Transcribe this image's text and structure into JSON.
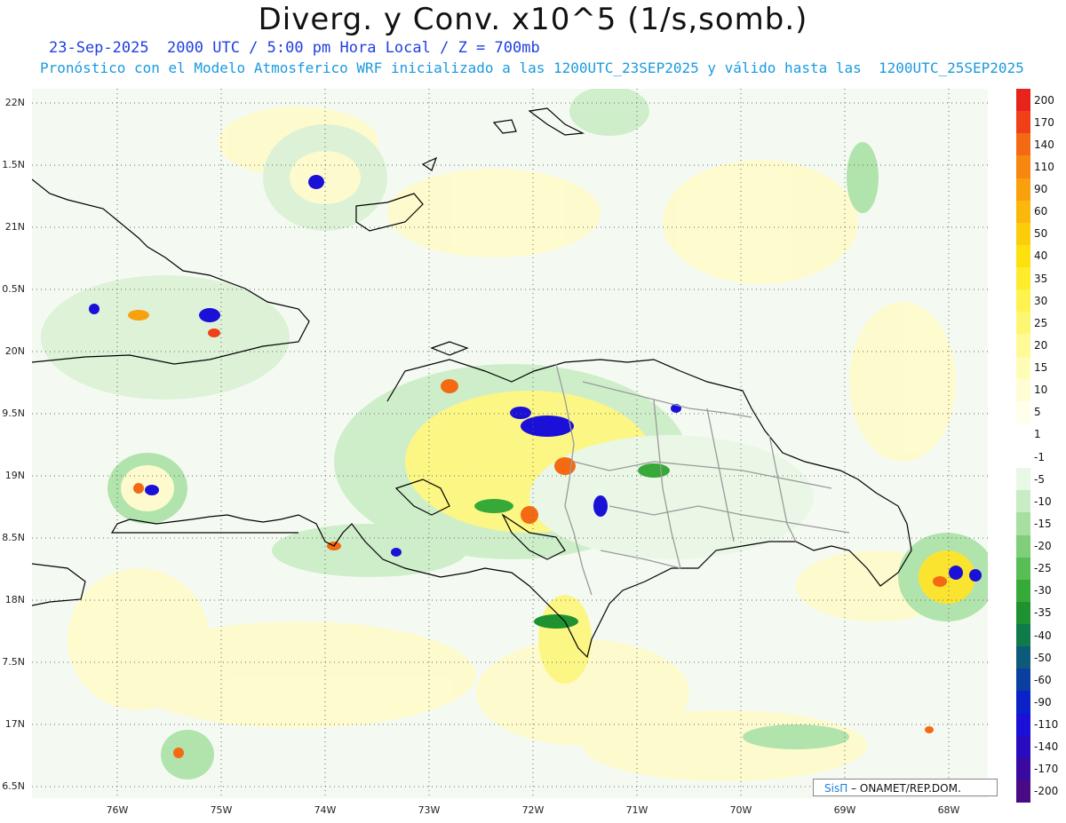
{
  "title": "Diverg. y Conv. x10^5 (1/s,somb.)",
  "subtitle_time": "23-Sep-2025  2000 UTC / 5:00 pm Hora Local / Z = 700mb",
  "subtitle_model": "Pronóstico con el Modelo Atmosferico WRF inicializado a las 1200UTC_23SEP2025 y válido hasta las  1200UTC_25SEP2025",
  "lat_labels": [
    "22N",
    "1.5N",
    "21N",
    "0.5N",
    "20N",
    "9.5N",
    "19N",
    "8.5N",
    "18N",
    "7.5N",
    "17N",
    "6.5N"
  ],
  "lon_labels": [
    "76W",
    "75W",
    "74W",
    "73W",
    "72W",
    "71W",
    "70W",
    "69W",
    "68W"
  ],
  "colorbar": {
    "labels": [
      "200",
      "170",
      "140",
      "110",
      "90",
      "60",
      "50",
      "40",
      "35",
      "30",
      "25",
      "20",
      "15",
      "10",
      "5",
      "1",
      "-1",
      "-5",
      "-10",
      "-15",
      "-20",
      "-25",
      "-30",
      "-35",
      "-40",
      "-50",
      "-60",
      "-90",
      "-110",
      "-140",
      "-170",
      "-200"
    ],
    "colors": [
      "#e8231c",
      "#f0401a",
      "#f46a12",
      "#f7870f",
      "#f9a00c",
      "#fbb70a",
      "#fccd0a",
      "#fde10e",
      "#fdeb2c",
      "#fef24e",
      "#fef672",
      "#fffa96",
      "#fffcb6",
      "#fffdd4",
      "#ffffec",
      "#ffffff",
      "#ffffff",
      "#e9f7e6",
      "#c8ecc4",
      "#a6dfa0",
      "#7fcf7a",
      "#58bd55",
      "#36a938",
      "#1e9230",
      "#0f7a4a",
      "#0e5a7a",
      "#0a3fa0",
      "#0a22c8",
      "#1a10d8",
      "#2a0cc0",
      "#3a0aa0",
      "#4a0a86"
    ]
  },
  "credit": {
    "brand": "SisΠ",
    "text": "– ONAMET/REP.DOM."
  },
  "colors": {
    "title": "#111111",
    "sub_time": "#1f3fe0",
    "sub_model": "#1a9ae0",
    "coast": "#000000",
    "borders": "#9a9a9a"
  }
}
